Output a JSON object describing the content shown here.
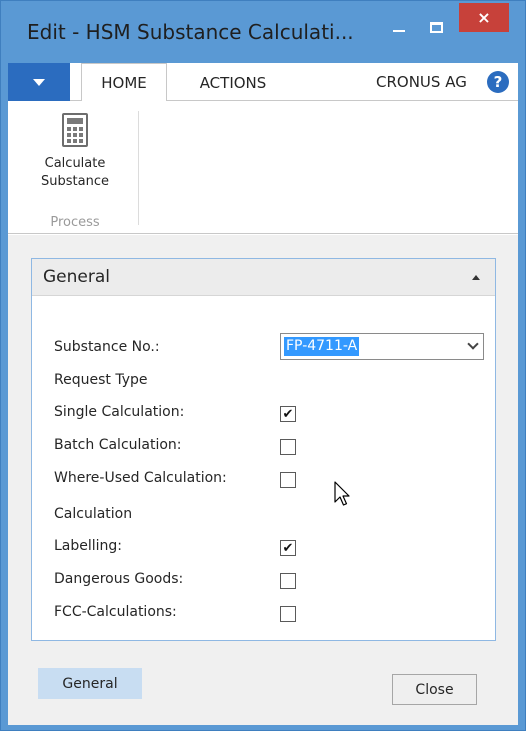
{
  "window": {
    "title": "Edit - HSM Substance Calculati...",
    "close_glyph": "×"
  },
  "ribbon": {
    "tabs": [
      {
        "label": "HOME",
        "selected": true
      },
      {
        "label": "ACTIONS",
        "selected": false
      }
    ],
    "company": "CRONUS AG",
    "help_glyph": "?",
    "actions": [
      {
        "label": "Calculate Substance",
        "icon": "calculator-icon"
      }
    ],
    "group_label": "Process"
  },
  "general": {
    "title": "General",
    "substance_no_label": "Substance No.:",
    "substance_no_value": "FP-4711-A",
    "request_type_header": "Request Type",
    "request_type": [
      {
        "label": "Single Calculation:",
        "checked": true
      },
      {
        "label": "Batch Calculation:",
        "checked": false
      },
      {
        "label": "Where-Used Calculation:",
        "checked": false
      }
    ],
    "calculation_header": "Calculation",
    "calculation": [
      {
        "label": "Labelling:",
        "checked": true
      },
      {
        "label": "Dangerous Goods:",
        "checked": false
      },
      {
        "label": "FCC-Calculations:",
        "checked": false
      }
    ]
  },
  "footer": {
    "tab_label": "General",
    "close_label": "Close"
  },
  "colors": {
    "titlebar": "#5a99d4",
    "file_tab": "#2b6cbf",
    "close_button": "#c7413a",
    "selection": "#3399ff",
    "fasttab_border": "#8fb8e3",
    "footer_tab": "#c8ddf2"
  }
}
